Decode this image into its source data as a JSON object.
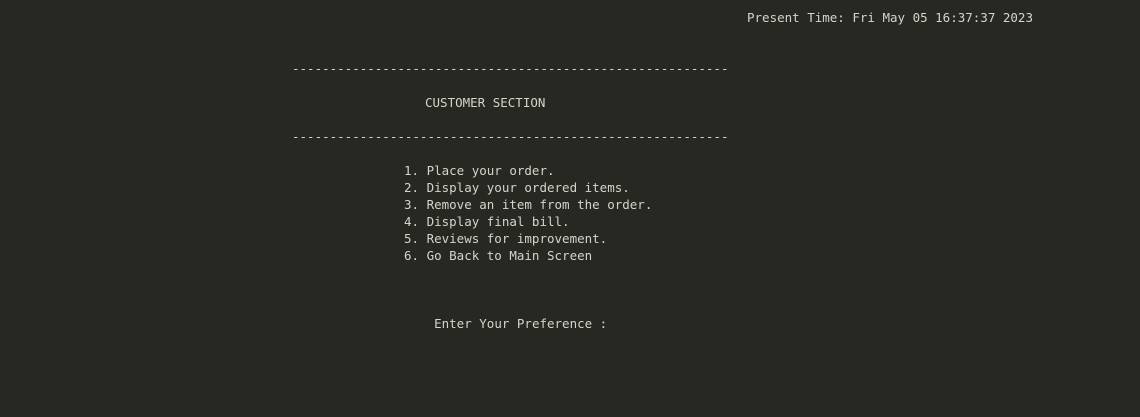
{
  "status": {
    "present_time": "Present Time: Fri May 05 16:37:37 2023"
  },
  "section": {
    "divider_top": "----------------------------------------------------------",
    "title": "CUSTOMER SECTION",
    "divider_bottom": "----------------------------------------------------------"
  },
  "menu": {
    "items": [
      {
        "label": "1. Place your order."
      },
      {
        "label": "2. Display your ordered items."
      },
      {
        "label": "3. Remove an item from the order."
      },
      {
        "label": "4. Display final bill."
      },
      {
        "label": "5. Reviews for improvement."
      },
      {
        "label": "6. Go Back to Main Screen"
      }
    ]
  },
  "prompt": {
    "text": "Enter Your Preference : "
  }
}
